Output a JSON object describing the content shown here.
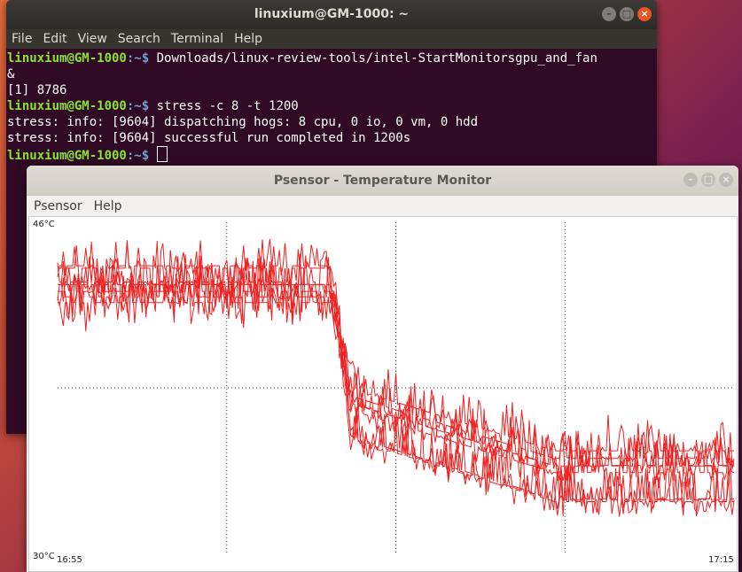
{
  "terminal": {
    "title": "linuxium@GM-1000: ~",
    "menu": [
      "File",
      "Edit",
      "View",
      "Search",
      "Terminal",
      "Help"
    ],
    "prompt_user": "linuxium@GM-1000",
    "prompt_path": ":~$",
    "lines": [
      {
        "type": "prompt",
        "cmd": " Downloads/linux-review-tools/intel-StartMonitorsgpu_and_fan"
      },
      {
        "type": "out",
        "text": "&"
      },
      {
        "type": "out",
        "text": "[1] 8786"
      },
      {
        "type": "prompt",
        "cmd": " stress -c 8 -t 1200"
      },
      {
        "type": "out",
        "text": "stress: info: [9604] dispatching hogs: 8 cpu, 0 io, 0 vm, 0 hdd"
      },
      {
        "type": "out",
        "text": "stress: info: [9604] successful run completed in 1200s"
      },
      {
        "type": "prompt",
        "cmd": " ",
        "cursor": true
      }
    ]
  },
  "psensor": {
    "title": "Psensor - Temperature Monitor",
    "menu": [
      "Psensor",
      "Help"
    ]
  },
  "chart_data": {
    "type": "line",
    "y_top_label": "46°C",
    "y_bottom_label": "30°C",
    "x_start_label": "16:55",
    "x_end_label": "17:15",
    "ylim": [
      30,
      46
    ],
    "grid": true,
    "line_color": "#ee2222",
    "series_count": 8,
    "phases": [
      {
        "from_min": 0,
        "to_min": 8.1,
        "temp_range": [
          41,
          45
        ]
      },
      {
        "from_min": 8.1,
        "to_min": 8.7,
        "temp_range": [
          37,
          44
        ]
      },
      {
        "from_min": 8.7,
        "to_min": 20,
        "temp_range": [
          31.5,
          37
        ]
      }
    ]
  },
  "colors": {
    "accent": "#e95420",
    "terminal_bg": "#300a24",
    "prompt_user": "#8ae234",
    "prompt_path": "#729fcf"
  }
}
